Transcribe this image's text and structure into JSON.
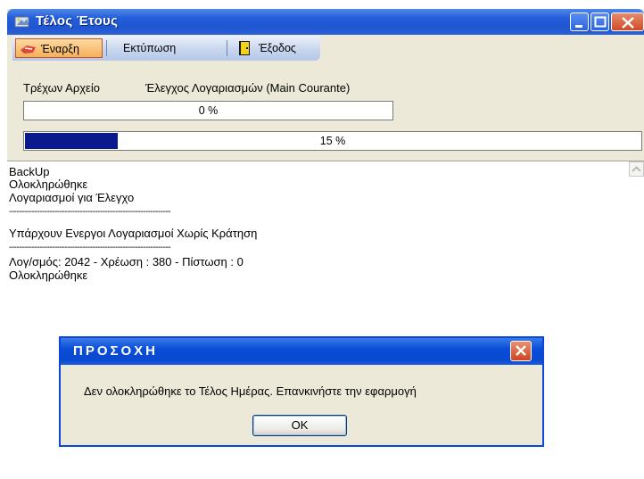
{
  "window": {
    "title": "Τέλος Έτους"
  },
  "toolbar": {
    "start_label": "Έναρξη",
    "print_label": "Εκτύπωση",
    "exit_label": "Έξοδος"
  },
  "status": {
    "current_file_label": "Τρέχων Αρχείο",
    "current_file_value": "Έλεγχος Λογαριασμών (Main Courante)"
  },
  "progress1": {
    "text": "0 %",
    "value": 0
  },
  "progress2": {
    "text": "15 %",
    "value": 15
  },
  "log": {
    "lines": [
      "BackUp",
      "Ολοκληρώθηκε",
      "Λογαριασμοί για Έλεγχο",
      "----------------------------------------------------------------",
      "Υπάρχουν Ενεργοι Λογαριασμοί Χωρίς Κράτηση",
      "----------------------------------------------------------------",
      "Λογ/σμός: 2042 - Χρέωση  : 380 - Πίστωση : 0",
      "Ολοκληρώθηκε"
    ]
  },
  "dialog": {
    "title": "ΠΡΟΣΟΧΗ",
    "message": "Δεν ολοκληρώθηκε το Τέλος Ημέρας. Επανκινήστε την εφαρμογή",
    "ok_label": "OK"
  },
  "colors": {
    "titlebar": "#245edb",
    "progress_fill": "#0a1a8c",
    "dialog_border": "#0a46d8"
  }
}
